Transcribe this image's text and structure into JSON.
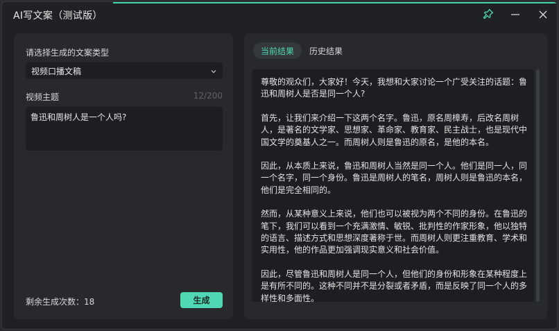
{
  "window": {
    "title": "AI写文案（测试版）",
    "accent_color": "#4fd8b3",
    "pin_icon": "pin-icon",
    "minimize_icon": "minimize-icon",
    "close_icon": "close-icon"
  },
  "left": {
    "type_label": "请选择生成的文案类型",
    "type_value": "视频口播文稿",
    "topic_label": "视频主题",
    "char_count": "12/200",
    "topic_value": "鲁迅和周树人是一个人吗?",
    "remaining_text": "剩余生成次数：18",
    "generate_label": "生成"
  },
  "right": {
    "tabs": [
      {
        "label": "当前结果"
      },
      {
        "label": "历史结果"
      }
    ],
    "paragraphs": [
      "尊敬的观众们，大家好！今天，我想和大家讨论一个广受关注的话题：鲁迅和周树人是否是同一个人?",
      "首先，让我们来介绍一下这两个名字。鲁迅，原名周樟寿，后改名周树人，是著名的文学家、思想家、革命家、教育家、民主战士，也是现代中国文学的奠基人之一。而周树人则是鲁迅的原名，是他的本名。",
      "因此，从本质上来说，鲁迅和周树人当然是同一个人。他们是同一人，同一个名字，同一个身份。鲁迅是周树人的笔名，周树人则是鲁迅的本名，他们是完全相同的。",
      "然而，从某种意义上来说，他们也可以被视为两个不同的身份。在鲁迅的笔下，我们可以看到一个充满激情、敏锐、批判性的作家形象，他以独特的语言、描述方式和思想深度著称于世。而周树人则更注重教育、学术和实用性，他的作品更加强调现实意义和社会价值。",
      "因此，尽管鲁迅和周树人是同一个人，但他们的身份和形象在某种程度上是有所不同的。这种不同并不是分裂或者矛盾，而是反映了同一个人的多样性和多面性。"
    ]
  }
}
